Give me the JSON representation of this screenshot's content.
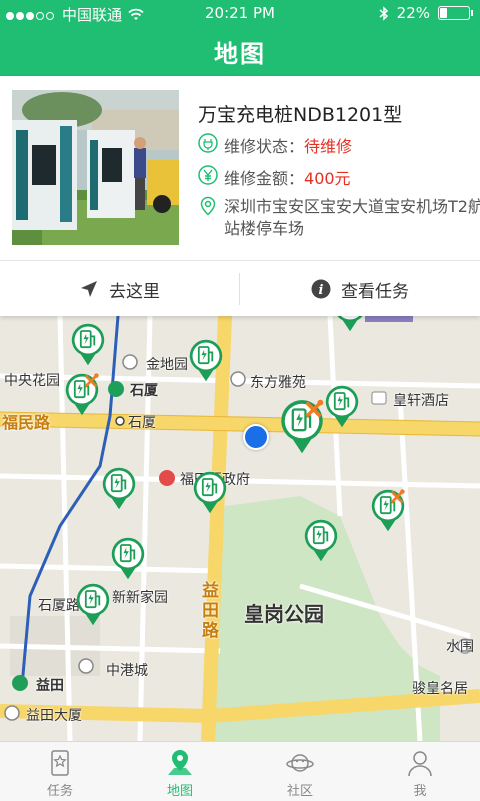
{
  "status_bar": {
    "carrier": "中国联通",
    "time": "20:21 PM",
    "battery": "22%",
    "battery_level": 0.22
  },
  "header": {
    "title": "地图"
  },
  "station": {
    "name": "万宝充电桩NDB1201型",
    "repair_status_label": "维修状态：",
    "repair_status_value": "待维修",
    "repair_amount_label": "维修金额：",
    "repair_amount_value": "400元",
    "address": "深圳市宝安区宝安大道宝安机场T2航站楼停车场"
  },
  "actions": {
    "navigate": "去这里",
    "view_task": "查看任务"
  },
  "map": {
    "labels": {
      "zhongyang_garden": "中央花园",
      "shixia_metro": "石厦",
      "shixia_road": "石厦",
      "jindiyuan": "金地园",
      "dongfang_yayuan": "东方雅苑",
      "huangxuan_hotel": "皇轩酒店",
      "fumin_road": "福民路",
      "futian_gov": "福田区政府",
      "yitian_road": "益田路",
      "huanggang_park": "皇岗公园",
      "shixia_road2": "石厦路",
      "xinxin_home": "新新家园",
      "zhonggang_city": "中港城",
      "yitian_metro": "益田",
      "yitian_building": "益田大厦",
      "shuiwei": "水围",
      "junhuang": "骏皇名居"
    }
  },
  "tabs": [
    {
      "label": "任务",
      "icon": "task-icon",
      "active": false
    },
    {
      "label": "地图",
      "icon": "map-pin-icon",
      "active": true
    },
    {
      "label": "社区",
      "icon": "planet-icon",
      "active": false
    },
    {
      "label": "我",
      "icon": "person-icon",
      "active": false
    }
  ],
  "colors": {
    "brand_green": "#1fbe72",
    "alert_red": "#e63022",
    "marker_green": "#1d9e57"
  }
}
